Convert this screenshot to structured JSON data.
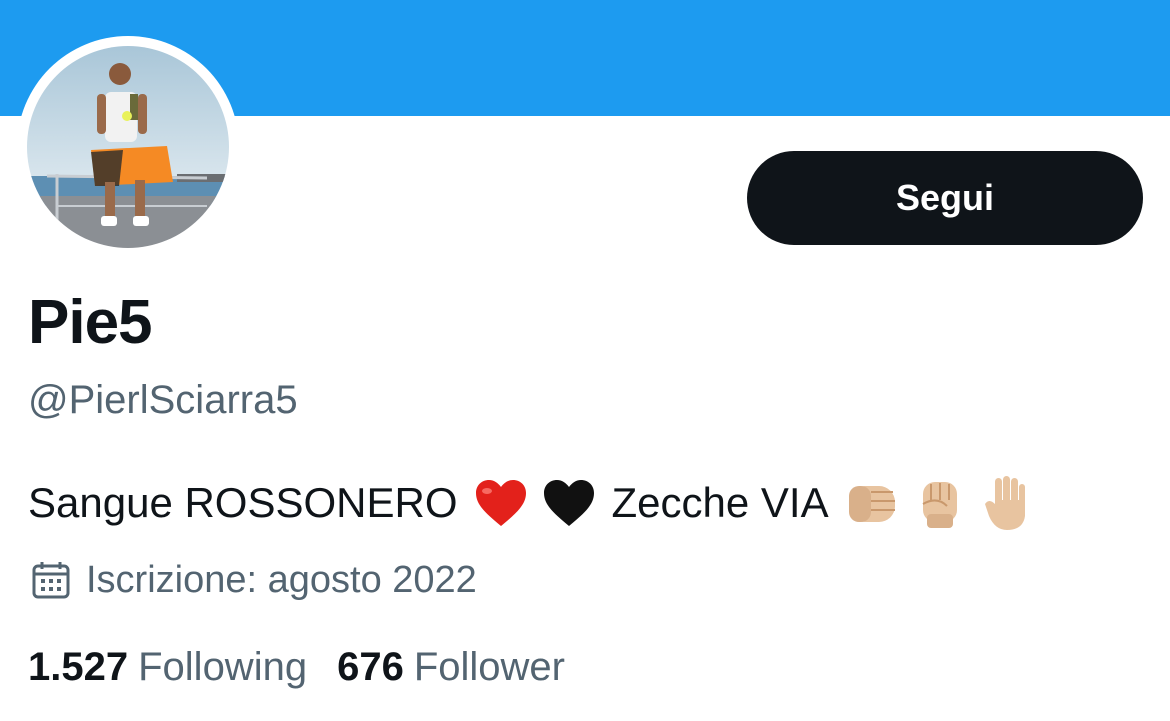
{
  "colors": {
    "banner": "#1d9bf0",
    "primary_text": "#0f1419",
    "secondary_text": "#536471",
    "button_bg": "#0f1419",
    "button_text": "#ffffff"
  },
  "profile": {
    "avatar_icon": "profile-photo",
    "display_name": "Pie5",
    "handle": "@PierlSciarra5",
    "follow_label": "Segui",
    "bio": {
      "text_before": "Sangue ROSSONERO",
      "text_middle": "Zecche VIA",
      "emojis_after_first": [
        "red-heart",
        "black-heart"
      ],
      "emojis_after_second": [
        "oncoming-fist",
        "raised-fist",
        "raised-hand"
      ]
    },
    "joined_icon": "calendar-icon",
    "joined": "Iscrizione: agosto 2022",
    "following_count": "1.527",
    "following_label": "Following",
    "followers_count": "676",
    "followers_label": "Follower"
  }
}
